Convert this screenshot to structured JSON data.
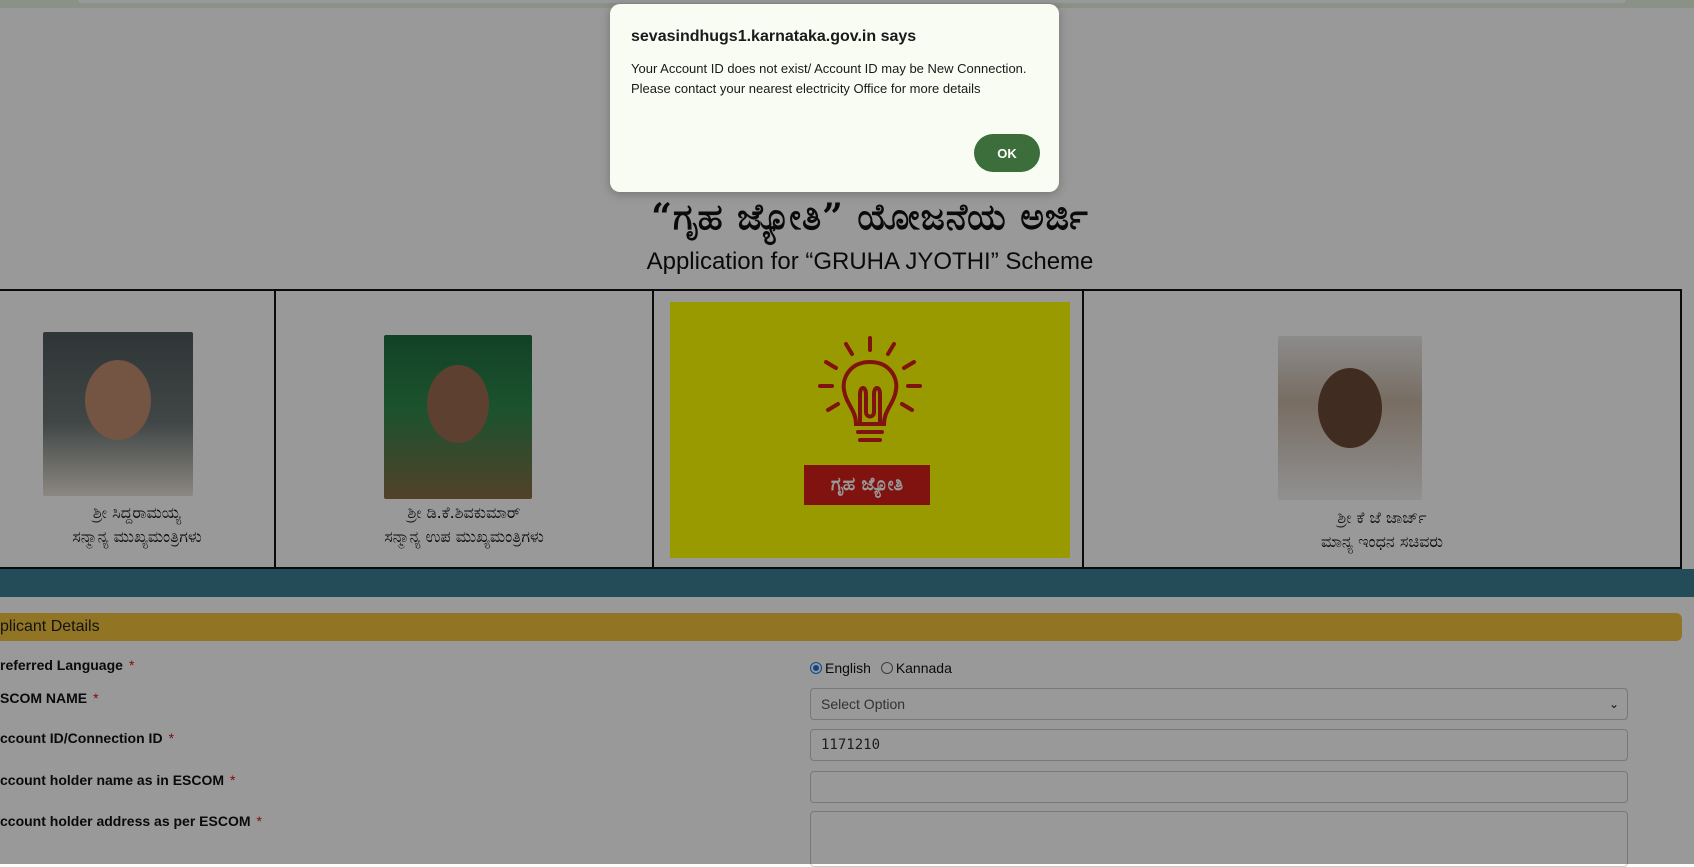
{
  "header": {
    "title_kannada": "“ಗೃಹ ಜ್ಯೋತಿ” ಯೋಜನೆಯ ಅರ್ಜಿ",
    "title_english": "Application for “GRUHA JYOTHI” Scheme"
  },
  "photos": [
    {
      "name": "ಶ್ರೀ ಸಿದ್ದರಾಮಯ್ಯ",
      "role": "ಸನ್ಮಾನ್ಯ ಮುಖ್ಯಮಂತ್ರಿಗಳು"
    },
    {
      "name": "ಶ್ರೀ ಡಿ.ಕೆ.ಶಿವಕುಮಾರ್",
      "role": "ಸನ್ಮಾನ್ಯ ಉಪ ಮುಖ್ಯಮಂತ್ರಿಗಳು"
    },
    {
      "logo_text": "ಗೃಹ ಜ್ಯೋತಿ"
    },
    {
      "name": "ಶ್ರೀ ಕೆ ಜೆ ಜಾರ್ಜ್",
      "role": "ಮಾನ್ಯ ಇಂಧನ ಸಚಿವರು"
    }
  ],
  "form": {
    "section_title": "plicant Details",
    "rows": [
      {
        "label": "referred Language"
      },
      {
        "label": "SCOM NAME"
      },
      {
        "label": "ccount ID/Connection ID"
      },
      {
        "label": "ccount holder name as in ESCOM"
      },
      {
        "label": "ccount holder address as per ESCOM"
      }
    ],
    "required_mark": "*",
    "language_options": [
      "English",
      "Kannada"
    ],
    "language_selected": "English",
    "escom_select_value": "Select Option",
    "account_id_value": "1171210",
    "holder_name_value": "",
    "holder_address_value": ""
  },
  "dialog": {
    "title": "sevasindhugs1.karnataka.gov.in says",
    "message_line1": "Your Account ID does not exist/ Account ID may be New Connection.",
    "message_line2": "Please contact your nearest electricity Office for more details",
    "ok_label": "OK"
  },
  "colors": {
    "section_header": "#f2c33c",
    "blue_band": "#3d7f93",
    "logo_yellow": "#ffff00",
    "logo_red": "#d6201a",
    "ok_button": "#3b6e3a"
  }
}
